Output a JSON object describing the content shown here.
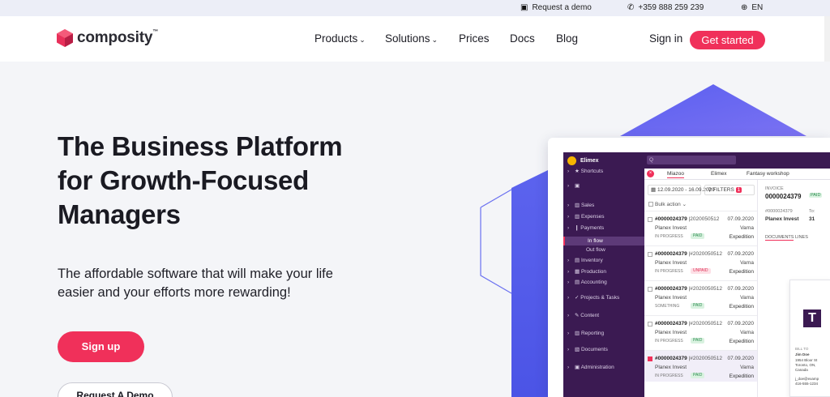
{
  "topbar": {
    "demo": "Request a demo",
    "phone": "+359 888 259 239",
    "lang": "EN",
    "icons": {
      "demo": "monitor-icon",
      "phone": "phone-icon",
      "lang": "globe-icon"
    }
  },
  "nav": {
    "logo": "composity",
    "logo_tm": "™",
    "products": "Products",
    "solutions": "Solutions",
    "prices": "Prices",
    "docs": "Docs",
    "blog": "Blog",
    "signin": "Sign in",
    "get_started": "Get started"
  },
  "hero": {
    "title": "The Business Platform for Growth-Focused Managers",
    "subtitle": "The affordable software that will make your life easier and your efforts more rewarding!",
    "signup": "Sign up",
    "demo": "Request A Demo"
  },
  "colors": {
    "accent": "#f0305a",
    "sidebar": "#3b1a52",
    "shape": "#6b6ff5"
  },
  "mock": {
    "company": "Elimex",
    "search_placeholder": "Q",
    "sidebar": [
      {
        "label": "Shortcuts",
        "icon": "star-icon"
      },
      {
        "label": "",
        "icon": "user-icon"
      },
      {
        "label": "Sales",
        "icon": "chart-icon"
      },
      {
        "label": "Expenses",
        "icon": "chart-icon"
      },
      {
        "label": "Payments",
        "icon": "payment-icon"
      },
      {
        "label": "In flow",
        "icon": "",
        "sub": true,
        "active": true
      },
      {
        "label": "Out flow",
        "icon": "",
        "sub": true
      },
      {
        "label": "Inventory",
        "icon": "box-icon"
      },
      {
        "label": "Production",
        "icon": "gear-icon"
      },
      {
        "label": "Accounting",
        "icon": "ledger-icon"
      },
      {
        "label": "Projects & Tasks",
        "icon": "check-icon"
      },
      {
        "label": "Content",
        "icon": "pen-icon"
      },
      {
        "label": "Reporting",
        "icon": "chart-icon"
      },
      {
        "label": "Documents",
        "icon": "docs-icon"
      },
      {
        "label": "Administration",
        "icon": "user-icon"
      }
    ],
    "tabs": [
      "Miazoo",
      "Elimex",
      "Fantasy workshop"
    ],
    "date_range": "12.09.2020 - 16.09.2020",
    "filters": "FILTERS",
    "filters_count": "1",
    "bulk": "Bulk action",
    "rows": [
      {
        "id": "#0000024379",
        "ref": "|2020050512",
        "date": "07.09.2020",
        "client": "Planex Invest",
        "city": "Varna",
        "status": "IN PROGRESS",
        "badge": "PAID",
        "badge_kind": "paid",
        "type": "Expedition"
      },
      {
        "id": "#0000024379",
        "ref": "|#2020050512",
        "date": "07.09.2020",
        "client": "Planex Invest",
        "city": "Varna",
        "status": "IN PROGRESS",
        "badge": "UNPAID",
        "badge_kind": "unpaid",
        "type": "Expedition"
      },
      {
        "id": "#0000024379",
        "ref": "|#2020050512",
        "date": "07.09.2020",
        "client": "Planex Invest",
        "city": "Varna",
        "status": "SOMETHING",
        "badge": "PAID",
        "badge_kind": "paid",
        "type": "Expedition"
      },
      {
        "id": "#0000024379",
        "ref": "|#2020050512",
        "date": "07.09.2020",
        "client": "Planex Invest",
        "city": "Varna",
        "status": "IN PROGRESS",
        "badge": "PAID",
        "badge_kind": "paid",
        "type": "Expedition"
      },
      {
        "id": "#0000024379",
        "ref": "|#2020050512",
        "date": "07.09.2020",
        "client": "Planex Invest",
        "city": "Varna",
        "status": "IN PROGRESS",
        "badge": "PAID",
        "badge_kind": "paid",
        "type": "Expedition",
        "checked": true
      }
    ],
    "detail": {
      "label": "INVOICE",
      "number": "0000024379",
      "chip": "PAID",
      "ref": "#0000024379",
      "to": "To:",
      "client": "Planex Invest",
      "num": "31",
      "tab_docs": "DOCUMENTS",
      "tab_lines": "LINES",
      "doc_logo": "T",
      "bill_to": "BILL TO",
      "bill_name": "Jim Doe",
      "bill_addr1": "1954 Bloor St",
      "bill_addr2": "Toronto, ON,",
      "bill_addr3": "Canada",
      "bill_email": "j_doe@examp",
      "bill_phone": "416-555-1234"
    }
  }
}
